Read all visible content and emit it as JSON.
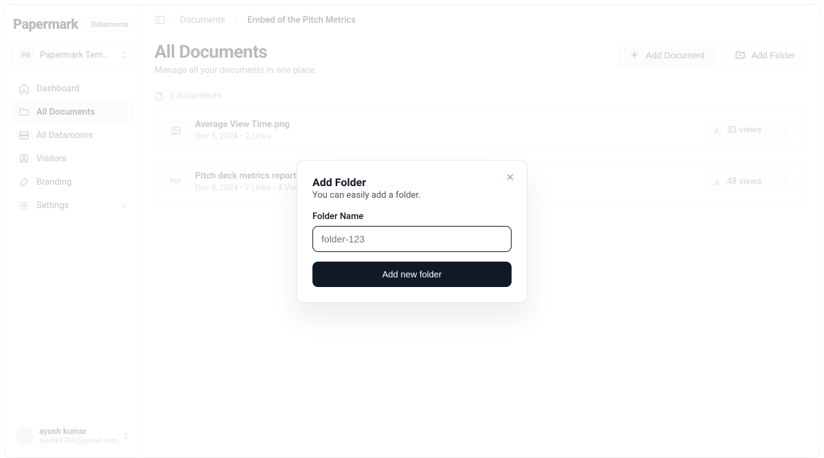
{
  "brand": {
    "name": "Papermark",
    "badge": "Datarooms"
  },
  "workspace": {
    "abbr": "PA",
    "name": "Papermark Templat..."
  },
  "sidebar": {
    "items": [
      {
        "label": "Dashboard"
      },
      {
        "label": "All Documents"
      },
      {
        "label": "All Datarooms"
      },
      {
        "label": "Visitors"
      },
      {
        "label": "Branding"
      },
      {
        "label": "Settings"
      }
    ]
  },
  "user": {
    "name": "ayush kumar",
    "email": "ayuhk1700@gmail.com"
  },
  "breadcrumb": {
    "root": "Documents",
    "current": "Embed of the Pitch Metrics"
  },
  "header": {
    "title": "All Documents",
    "subtitle": "Manage all your documents in one place.",
    "add_doc": "Add Document",
    "add_folder": "Add Folder"
  },
  "count": "2 documents",
  "docs": [
    {
      "title": "Average View Time.png",
      "meta": "Dec 5, 2024 • 2 Links",
      "views": "33 views",
      "type": "image"
    },
    {
      "title": "Pitch deck metrics report.pdf",
      "meta": "Dec 4, 2024 • 7 Links • 4 Versions",
      "views": "48 views",
      "type": "pdf",
      "pdf_label": "PDF"
    }
  ],
  "modal": {
    "title": "Add Folder",
    "desc": "You can easily add a folder.",
    "label": "Folder Name",
    "placeholder": "folder-123",
    "submit": "Add new folder"
  }
}
